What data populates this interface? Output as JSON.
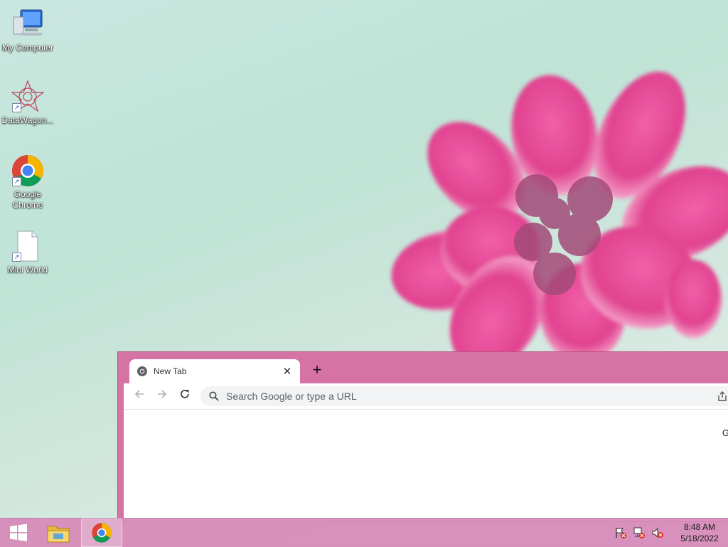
{
  "desktop": {
    "icons": [
      {
        "label": "My Computer",
        "icon": "computer-icon"
      },
      {
        "label": "DataWagon...",
        "icon": "datawagon-icon"
      },
      {
        "label": "Google Chrome",
        "icon": "chrome-icon"
      },
      {
        "label": "Mini World",
        "icon": "file-icon"
      }
    ]
  },
  "browser": {
    "tab": {
      "title": "New Tab",
      "close": "✕"
    },
    "new_tab_symbol": "+",
    "omnibox": {
      "placeholder": "Search Google or type a URL"
    },
    "page": {
      "gmail": "Gma"
    },
    "colors": {
      "frame": "#d573a4",
      "accent": "#d573a4"
    }
  },
  "taskbar": {
    "clock": {
      "time": "8:48 AM",
      "date": "5/18/2022"
    },
    "pinned": [
      "start-icon",
      "file-explorer-icon",
      "chrome-icon"
    ]
  }
}
